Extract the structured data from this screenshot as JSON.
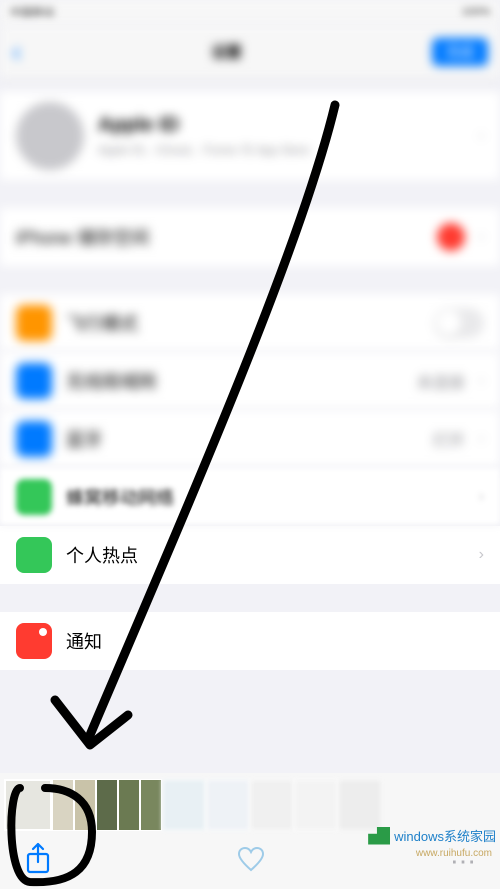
{
  "status": {
    "left": "中国移动",
    "right": "100%"
  },
  "nav": {
    "title": "设置",
    "action": "完成"
  },
  "profile": {
    "name": "Apple ID",
    "sub": "Apple ID、iCloud、iTunes 与 App Store"
  },
  "update_row": {
    "label": "iPhone 储存空间"
  },
  "rows": {
    "airplane": "飞行模式",
    "wifi": "无线局域网",
    "bt": "蓝牙",
    "cellular": "蜂窝移动网络",
    "hotspot": "个人热点",
    "notify": "通知"
  },
  "row_values": {
    "wifi": "未连接",
    "bt": "打开"
  },
  "watermark": {
    "brand": "windows系统家园",
    "url": "www.ruihufu.com"
  }
}
